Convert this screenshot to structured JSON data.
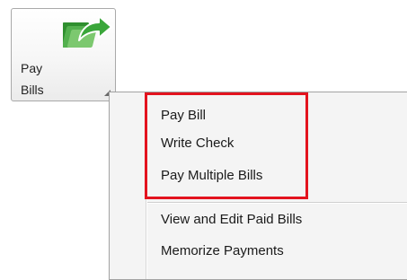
{
  "ribbon_button": {
    "label_line1": "Pay",
    "label_line2": "Bills",
    "icon": "money-arrow-icon"
  },
  "menu": {
    "items": [
      {
        "label": "Pay Bill"
      },
      {
        "label": "Write Check"
      },
      {
        "label": "Pay Multiple Bills"
      },
      {
        "label": "View and Edit Paid Bills"
      },
      {
        "label": "Memorize Payments"
      }
    ]
  },
  "colors": {
    "highlight": "#e3131e",
    "icon_green": "#3aa63a",
    "menu_background": "#f4f4f4"
  }
}
